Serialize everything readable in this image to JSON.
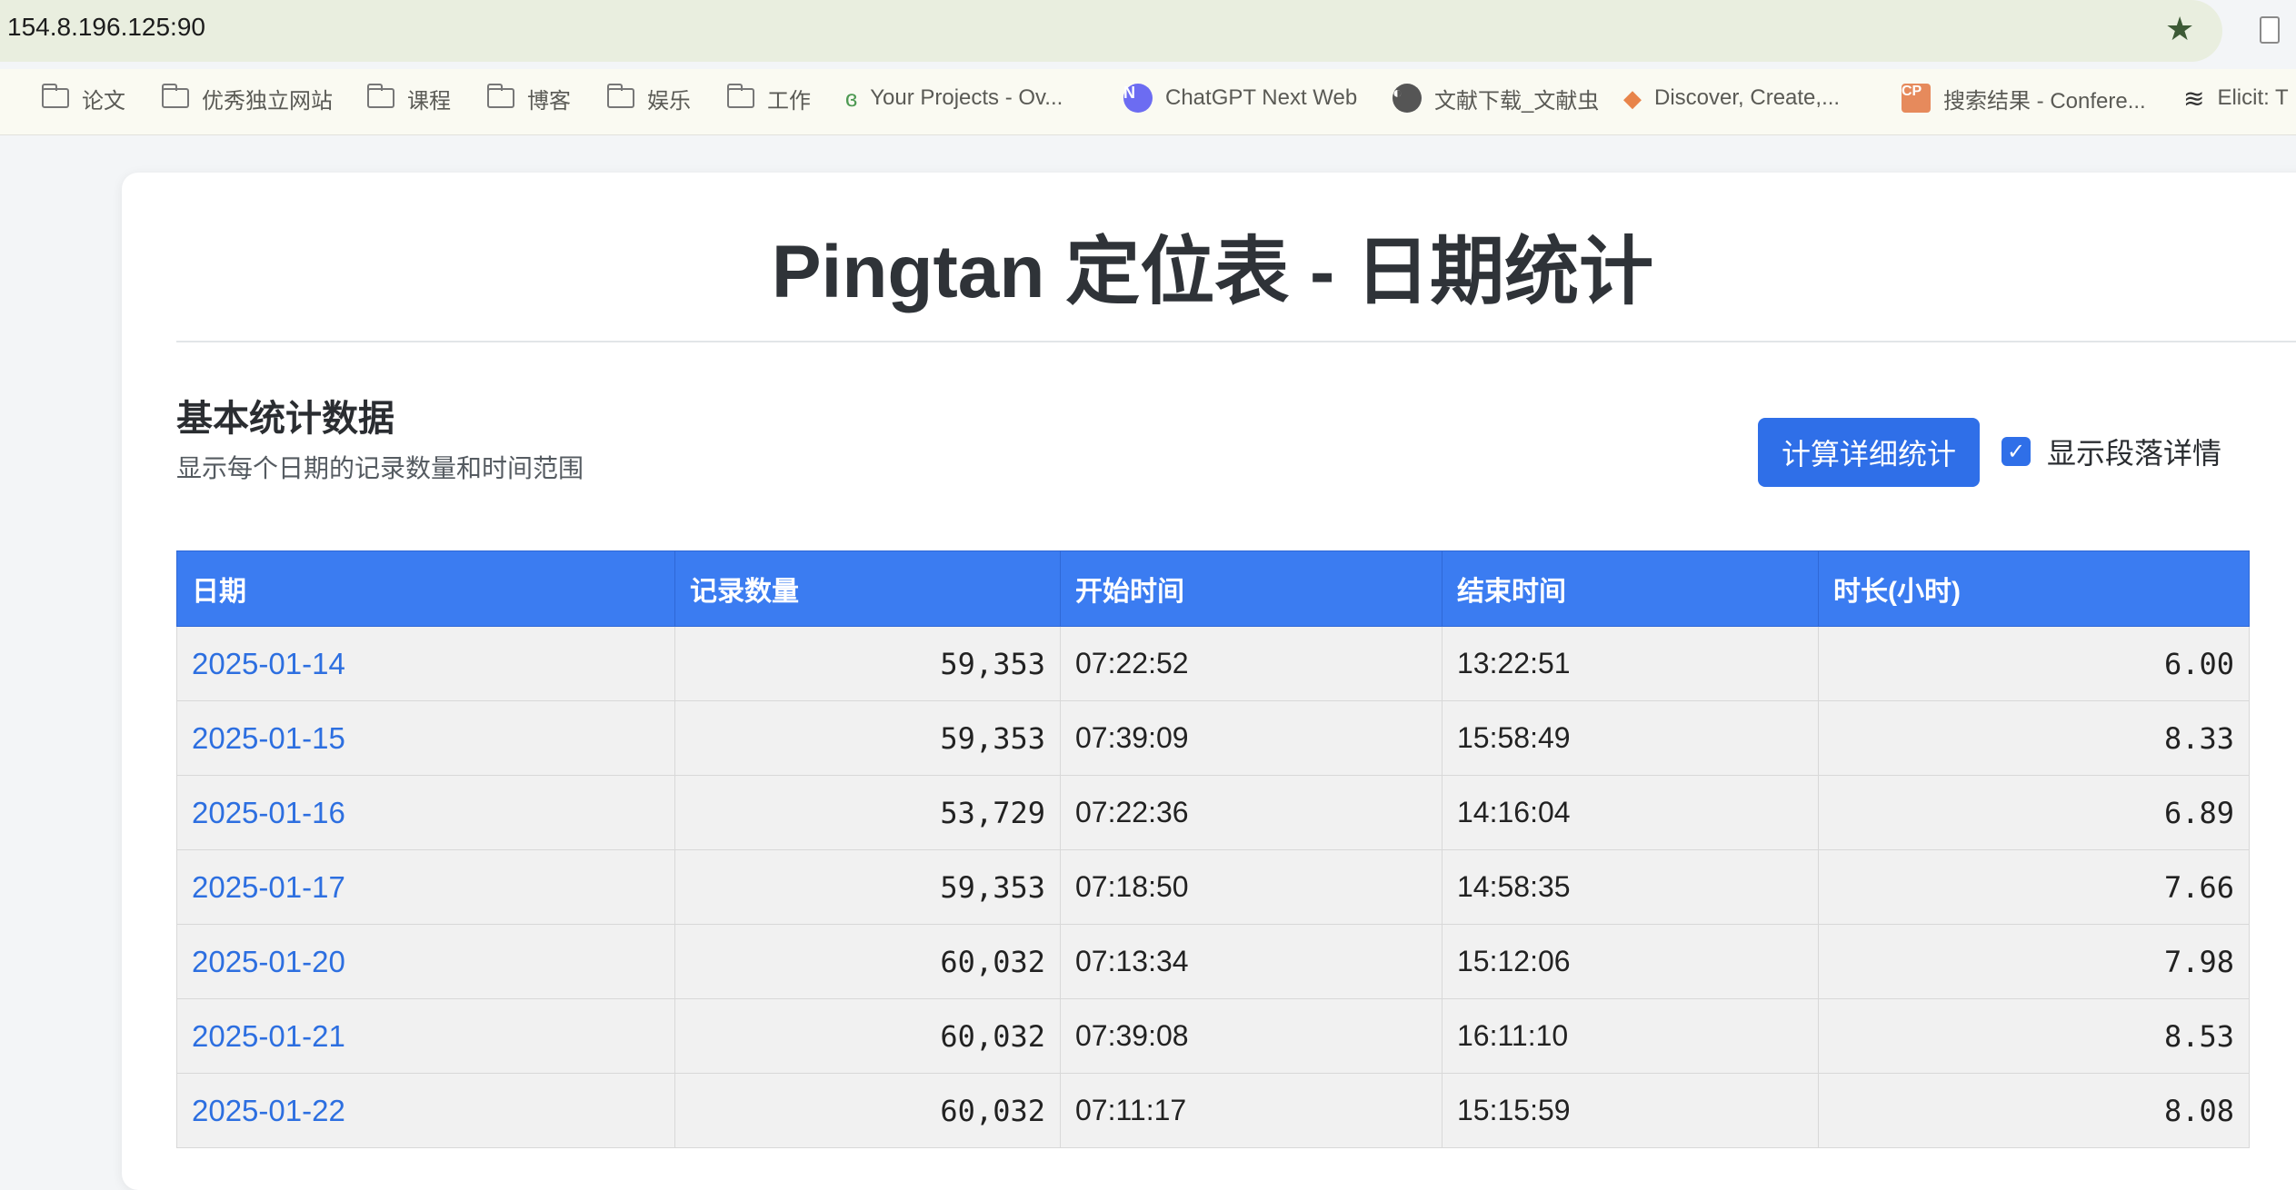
{
  "browser": {
    "url": "154.8.196.125:90",
    "bookmarks": [
      {
        "label": "论文",
        "icon": "folder-icon"
      },
      {
        "label": "优秀独立网站",
        "icon": "folder-icon"
      },
      {
        "label": "课程",
        "icon": "folder-icon"
      },
      {
        "label": "博客",
        "icon": "folder-icon"
      },
      {
        "label": "娱乐",
        "icon": "folder-icon"
      },
      {
        "label": "工作",
        "icon": "folder-icon"
      },
      {
        "label": "Your Projects - Ov...",
        "icon": "overleaf-icon"
      },
      {
        "label": "ChatGPT Next Web",
        "icon": "chatgpt-next-web-icon"
      },
      {
        "label": "文献下载_文献虫",
        "icon": "globe-icon"
      },
      {
        "label": "Discover, Create,...",
        "icon": "layers-icon"
      },
      {
        "label": "搜索结果 - Confere...",
        "icon": "cp-icon"
      },
      {
        "label": "Elicit: T",
        "icon": "elicit-icon"
      }
    ]
  },
  "page": {
    "title": "Pingtan 定位表 - 日期统计",
    "section_title": "基本统计数据",
    "section_subtitle": "显示每个日期的记录数量和时间范围",
    "calc_button": "计算详细统计",
    "show_details_label": "显示段落详情",
    "show_details_checked": true
  },
  "table": {
    "headers": [
      "日期",
      "记录数量",
      "开始时间",
      "结束时间",
      "时长(小时)"
    ],
    "rows": [
      [
        "2025-01-14",
        "59,353",
        "07:22:52",
        "13:22:51",
        "6.00"
      ],
      [
        "2025-01-15",
        "59,353",
        "07:39:09",
        "15:58:49",
        "8.33"
      ],
      [
        "2025-01-16",
        "53,729",
        "07:22:36",
        "14:16:04",
        "6.89"
      ],
      [
        "2025-01-17",
        "59,353",
        "07:18:50",
        "14:58:35",
        "7.66"
      ],
      [
        "2025-01-20",
        "60,032",
        "07:13:34",
        "15:12:06",
        "7.98"
      ],
      [
        "2025-01-21",
        "60,032",
        "07:39:08",
        "16:11:10",
        "8.53"
      ],
      [
        "2025-01-22",
        "60,032",
        "07:11:17",
        "15:15:59",
        "8.08"
      ]
    ]
  },
  "colors": {
    "accent": "#3b7cf1",
    "link": "#2d6fe0",
    "urlbar": "#e9eedf"
  }
}
